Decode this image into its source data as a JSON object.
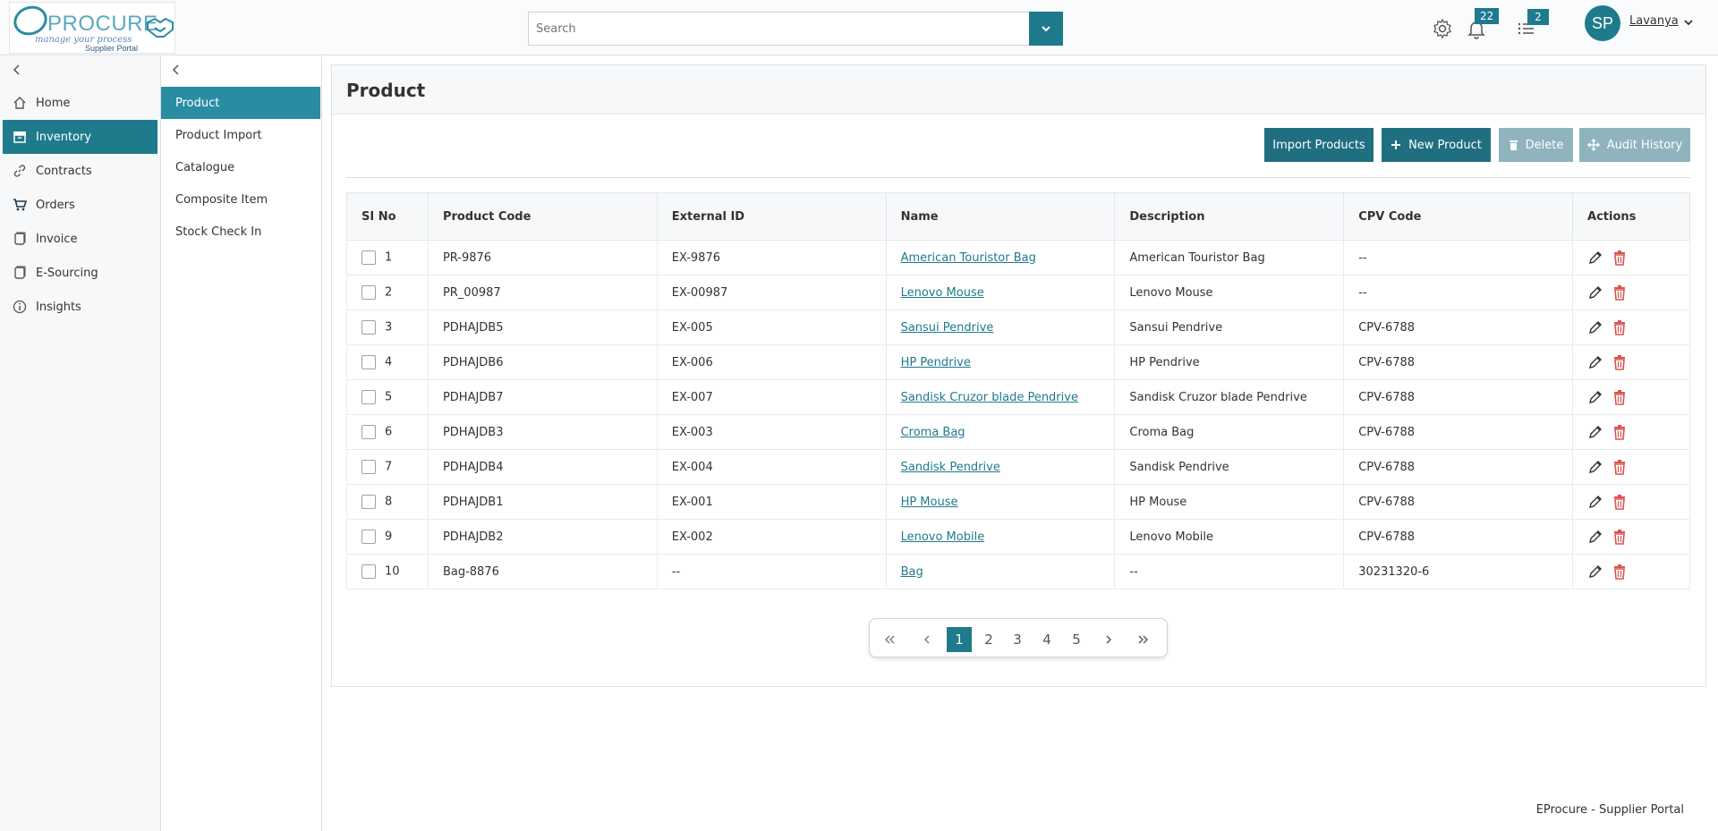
{
  "header": {
    "logo": {
      "brand": "PROCURE",
      "tagline": "manage your process",
      "subtitle": "Supplier Portal"
    },
    "search": {
      "placeholder": "Search"
    },
    "notifications": {
      "count": "22"
    },
    "tasks": {
      "count": "2"
    },
    "user": {
      "initials": "SP",
      "name": "Lavanya"
    }
  },
  "sidebar": {
    "items": [
      {
        "label": "Home",
        "icon": "home-icon",
        "active": false
      },
      {
        "label": "Inventory",
        "icon": "archive-icon",
        "active": true
      },
      {
        "label": "Contracts",
        "icon": "link-icon",
        "active": false
      },
      {
        "label": "Orders",
        "icon": "cart-icon",
        "active": false
      },
      {
        "label": "Invoice",
        "icon": "document-icon",
        "active": false
      },
      {
        "label": "E-Sourcing",
        "icon": "document-icon",
        "active": false
      },
      {
        "label": "Insights",
        "icon": "info-icon",
        "active": false
      }
    ]
  },
  "subnav": {
    "items": [
      {
        "label": "Product",
        "active": true
      },
      {
        "label": "Product Import",
        "active": false
      },
      {
        "label": "Catalogue",
        "active": false
      },
      {
        "label": "Composite Item",
        "active": false
      },
      {
        "label": "Stock Check In",
        "active": false
      }
    ]
  },
  "main": {
    "title": "Product",
    "buttons": {
      "import": "Import Products",
      "new": "New Product",
      "delete": "Delete",
      "audit": "Audit History"
    },
    "table": {
      "columns": [
        "SI No",
        "Product Code",
        "External ID",
        "Name",
        "Description",
        "CPV Code",
        "Actions"
      ],
      "rows": [
        {
          "si": "1",
          "code": "PR-9876",
          "ext": "EX-9876",
          "name": "American Touristor Bag ",
          "desc": "American Touristor Bag",
          "cpv": "--"
        },
        {
          "si": "2",
          "code": "PR_00987",
          "ext": "EX-00987",
          "name": "Lenovo Mouse ",
          "desc": "Lenovo Mouse",
          "cpv": "--"
        },
        {
          "si": "3",
          "code": "PDHAJDB5",
          "ext": "EX-005",
          "name": "Sansui Pendrive ",
          "desc": "Sansui Pendrive",
          "cpv": "CPV-6788"
        },
        {
          "si": "4",
          "code": "PDHAJDB6",
          "ext": "EX-006",
          "name": "HP Pendrive ",
          "desc": "HP Pendrive",
          "cpv": "CPV-6788"
        },
        {
          "si": "5",
          "code": "PDHAJDB7",
          "ext": "EX-007",
          "name": "Sandisk Cruzor blade Pendrive ",
          "desc": "Sandisk Cruzor blade Pendrive",
          "cpv": "CPV-6788"
        },
        {
          "si": "6",
          "code": "PDHAJDB3",
          "ext": "EX-003",
          "name": "Croma Bag ",
          "desc": "Croma Bag",
          "cpv": "CPV-6788"
        },
        {
          "si": "7",
          "code": "PDHAJDB4",
          "ext": "EX-004",
          "name": "Sandisk Pendrive ",
          "desc": "Sandisk Pendrive",
          "cpv": "CPV-6788"
        },
        {
          "si": "8",
          "code": "PDHAJDB1",
          "ext": "EX-001",
          "name": "HP Mouse ",
          "desc": "HP Mouse",
          "cpv": "CPV-6788"
        },
        {
          "si": "9",
          "code": "PDHAJDB2",
          "ext": "EX-002",
          "name": "Lenovo Mobile ",
          "desc": "Lenovo Mobile",
          "cpv": "CPV-6788"
        },
        {
          "si": "10",
          "code": "Bag-8876",
          "ext": "--",
          "name": "Bag ",
          "desc": "--",
          "cpv": "30231320-6"
        }
      ]
    },
    "pagination": {
      "pages": [
        "1",
        "2",
        "3",
        "4",
        "5"
      ],
      "current": "1"
    }
  },
  "footer": {
    "text": "EProcure - Supplier Portal"
  },
  "colors": {
    "accent": "#1f7a8c",
    "accent_light": "#2a8ca3",
    "disabled": "#8fb4bd",
    "danger": "#d9534f"
  }
}
